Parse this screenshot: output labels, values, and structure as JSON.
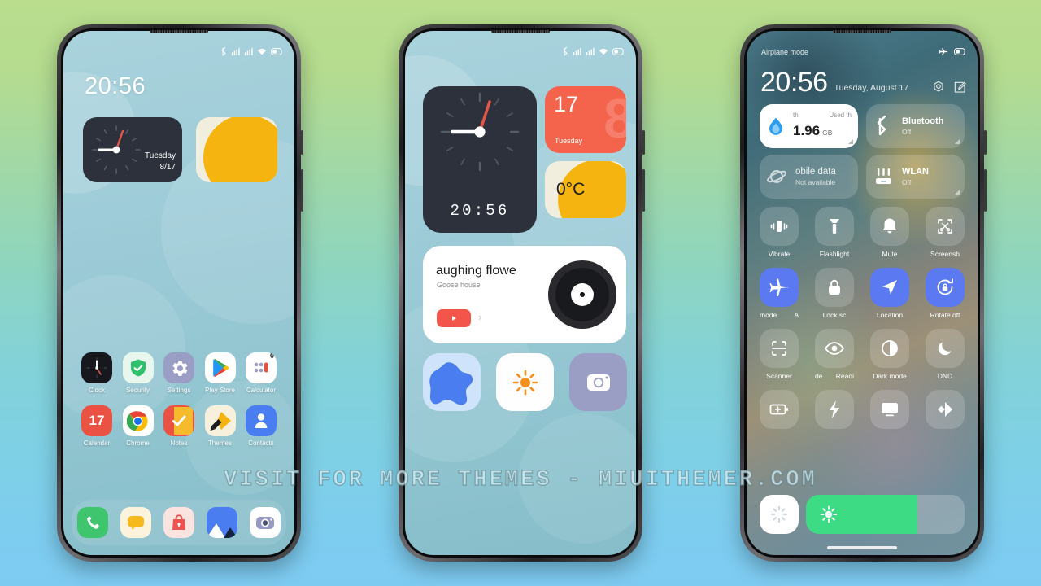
{
  "background": {
    "top_color": "#b9dd8d",
    "bottom_color": "#7ecbf2"
  },
  "watermark": {
    "text": "VISIT FOR MORE THEMES - MIUITHEMER.COM"
  },
  "phone1": {
    "statusbar": {
      "icons": [
        "bluetooth-icon",
        "signal-icon",
        "signal-icon",
        "wifi-icon",
        "battery-icon"
      ]
    },
    "clock_time": "20:56",
    "clock_widget": {
      "weekday": "Tuesday",
      "date": "8/17"
    },
    "apps_row1": [
      {
        "label": "Clock",
        "icon": "clock-icon"
      },
      {
        "label": "Security",
        "icon": "shield-check-icon"
      },
      {
        "label": "Settings",
        "icon": "gear-icon"
      },
      {
        "label": "Play Store",
        "icon": "play-store-icon"
      },
      {
        "label": "Calculator",
        "icon": "calculator-icon",
        "badge": "0"
      }
    ],
    "apps_row2": [
      {
        "label": "Calendar",
        "icon": "calendar-icon",
        "day": "17"
      },
      {
        "label": "Chrome",
        "icon": "chrome-icon"
      },
      {
        "label": "Notes",
        "icon": "notes-check-icon"
      },
      {
        "label": "Themes",
        "icon": "themes-brush-icon"
      },
      {
        "label": "Contacts",
        "icon": "contacts-person-icon"
      }
    ],
    "dock": [
      {
        "label": "Phone",
        "icon": "phone-handset-icon"
      },
      {
        "label": "Messages",
        "icon": "messages-bubble-icon"
      },
      {
        "label": "Mi Store",
        "icon": "shopping-bag-icon"
      },
      {
        "label": "Gallery",
        "icon": "gallery-mountain-icon"
      },
      {
        "label": "Camera",
        "icon": "camera-icon"
      }
    ]
  },
  "phone2": {
    "statusbar": {
      "icons": [
        "bluetooth-icon",
        "signal-icon",
        "signal-icon",
        "wifi-icon",
        "battery-icon"
      ]
    },
    "clock_widget": {
      "digital": "20:56"
    },
    "calendar_widget": {
      "day": "17",
      "weekday": "Tuesday",
      "ghost": "8"
    },
    "weather_widget": {
      "temperature": "0°C"
    },
    "music_widget": {
      "title": "aughing flowe",
      "artist": "Goose house",
      "source_icon": "youtube-icon",
      "chevron": "›"
    },
    "tiles": [
      {
        "name": "puzzle-blob-tile",
        "icon": "puzzle-icon"
      },
      {
        "name": "weather-sun-tile",
        "icon": "sun-icon"
      },
      {
        "name": "camera-tile",
        "icon": "camera-icon"
      }
    ]
  },
  "phone3": {
    "status_label": "Airplane mode",
    "status_icons": [
      "airplane-icon",
      "battery-icon"
    ],
    "clock": "20:56",
    "date": "Tuesday, August 17",
    "header_actions": [
      "settings-gear-icon",
      "edit-icon"
    ],
    "big_tiles": [
      {
        "name": "data-usage",
        "state": "on",
        "label_left": "th",
        "label_right": "Used th",
        "value": "1.96",
        "unit": "GB",
        "icon": "water-drop-icon"
      },
      {
        "name": "bluetooth",
        "title": "Bluetooth",
        "sub": "Off",
        "icon": "bluetooth-icon",
        "state": "off"
      },
      {
        "name": "mobile-data",
        "title": "obile data",
        "sub": "Not available",
        "icon": "planet-icon",
        "state": "off"
      },
      {
        "name": "wlan",
        "title": "WLAN",
        "sub": "Off",
        "icon": "wlan-router-icon",
        "state": "off"
      }
    ],
    "toggles": [
      {
        "label": "Vibrate",
        "icon": "vibrate-icon",
        "active": false
      },
      {
        "label": "Flashlight",
        "icon": "flashlight-icon",
        "active": false
      },
      {
        "label": "Mute",
        "icon": "bell-icon",
        "active": false
      },
      {
        "label": "Screensh",
        "icon": "screenshot-scissors-icon",
        "active": false
      },
      {
        "label": "mode",
        "label_right": "A",
        "icon": "airplane-icon",
        "active": true
      },
      {
        "label": "Lock sc",
        "icon": "lock-icon",
        "active": false
      },
      {
        "label": "Location",
        "icon": "location-arrow-icon",
        "active": true
      },
      {
        "label": "Rotate off",
        "icon": "rotate-lock-icon",
        "active": true
      },
      {
        "label": "Scanner",
        "icon": "scan-frame-icon",
        "active": false
      },
      {
        "label": "de",
        "label_right": "Readi",
        "icon": "eye-icon",
        "active": false
      },
      {
        "label": "Dark mode",
        "icon": "contrast-circle-icon",
        "active": false
      },
      {
        "label": "DND",
        "icon": "moon-icon",
        "active": false
      },
      {
        "label": "",
        "icon": "battery-saver-icon",
        "active": false
      },
      {
        "label": "",
        "icon": "lightning-icon",
        "active": false
      },
      {
        "label": "",
        "icon": "cast-screen-icon",
        "active": false
      },
      {
        "label": "",
        "icon": "second-space-icon",
        "active": false
      }
    ],
    "brightness": {
      "auto_icon": "auto-brightness-icon",
      "slider_icon": "sun-icon",
      "fill_percent": 70,
      "accent": "#3ddc84"
    }
  }
}
